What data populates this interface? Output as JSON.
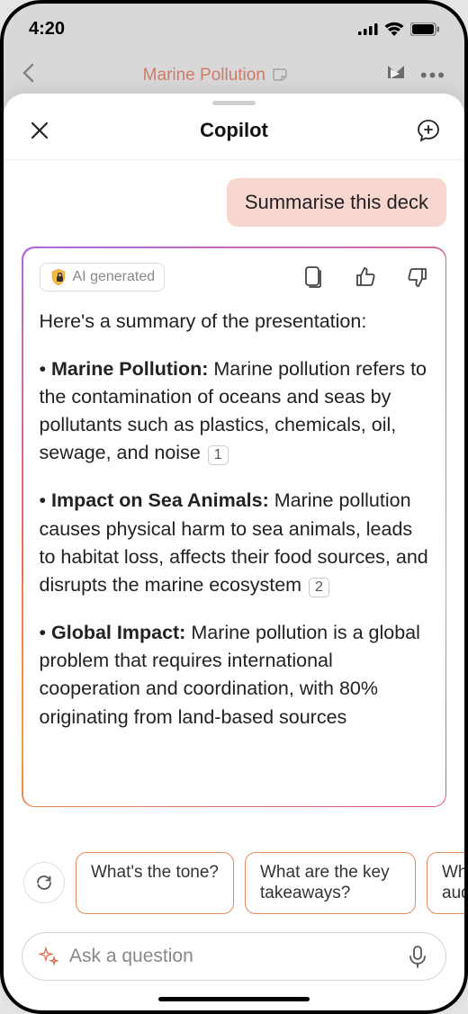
{
  "status": {
    "time": "4:20"
  },
  "bg_header": {
    "title": "Marine Pollution"
  },
  "sheet": {
    "title": "Copilot"
  },
  "user_message": "Summarise this deck",
  "ai_badge": "AI generated",
  "summary_intro": "Here's a summary of the presentation:",
  "bullets": [
    {
      "title": "Marine Pollution:",
      "body": "Marine pollution refers to the contamination of oceans and seas by pollutants such as plastics, chemicals, oil, sewage, and noise",
      "ref": "1"
    },
    {
      "title": "Impact on Sea Animals:",
      "body": "Marine pollution causes physical harm to sea animals, leads to habitat loss, affects their food sources, and disrupts the marine ecosystem",
      "ref": "2"
    },
    {
      "title": "Global Impact:",
      "body": "Marine pollution is a global problem that requires international cooperation and coordination, with 80% originating from land-based sources",
      "ref": ""
    }
  ],
  "suggestions": [
    "What's the tone?",
    "What are the key takeaways?",
    "Who's the audience?"
  ],
  "input": {
    "placeholder": "Ask a question"
  }
}
